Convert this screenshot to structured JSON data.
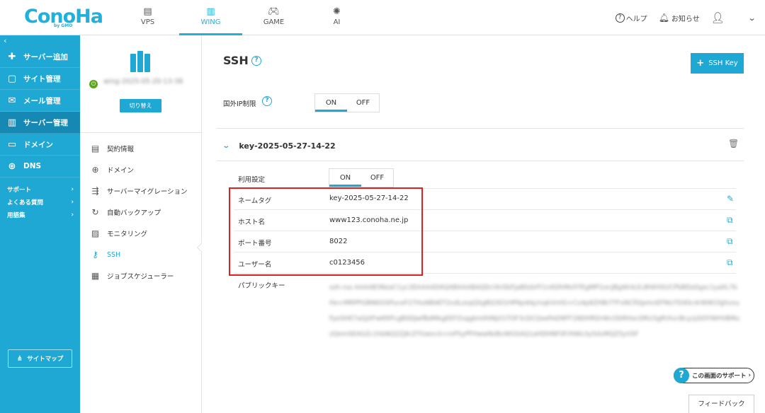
{
  "brand": {
    "logo": "ConoHa",
    "logo_sub": "by GMO",
    "accent": "#1fa8d4"
  },
  "topnav": [
    {
      "label": "VPS",
      "icon": "server-stack-icon"
    },
    {
      "label": "WING",
      "icon": "wing-server-icon",
      "active": true
    },
    {
      "label": "GAME",
      "icon": "gamepad-icon"
    },
    {
      "label": "AI",
      "icon": "ai-chip-icon"
    }
  ],
  "topright": {
    "help": "ヘルプ",
    "notice": "お知らせ"
  },
  "sidebar": {
    "items": [
      {
        "label": "サーバー追加",
        "icon": "plus-icon"
      },
      {
        "label": "サイト管理",
        "icon": "window-icon"
      },
      {
        "label": "メール管理",
        "icon": "mail-icon"
      },
      {
        "label": "サーバー管理",
        "icon": "server-icon",
        "active": true
      },
      {
        "label": "ドメイン",
        "icon": "domain-icon"
      },
      {
        "label": "DNS",
        "icon": "globe-icon"
      }
    ],
    "links": [
      "サポート",
      "よくある質問",
      "用語集"
    ],
    "sitemap": "サイトマップ"
  },
  "server": {
    "name": "wing-2025-05-20-13-38",
    "switch_label": "切り替え"
  },
  "subnav": [
    {
      "label": "契約情報",
      "icon": "contract-icon"
    },
    {
      "label": "ドメイン",
      "icon": "globe-icon"
    },
    {
      "label": "サーバーマイグレーション",
      "icon": "migration-icon"
    },
    {
      "label": "自動バックアップ",
      "icon": "backup-icon"
    },
    {
      "label": "モニタリング",
      "icon": "chart-icon"
    },
    {
      "label": "SSH",
      "icon": "key-icon",
      "active": true
    },
    {
      "label": "ジョブスケジューラー",
      "icon": "scheduler-icon"
    }
  ],
  "main": {
    "title": "SSH",
    "add_key_label": "SSH Key",
    "ip_restrict_label": "国外IP制限",
    "toggle_on": "ON",
    "toggle_off": "OFF",
    "key_name": "key-2025-05-27-14-22",
    "use_setting_label": "利用設定",
    "rows": [
      {
        "key": "ネームタグ",
        "value": "key-2025-05-27-14-22",
        "action": "pencil-icon"
      },
      {
        "key": "ホスト名",
        "value": "www123.conoha.ne.jp",
        "action": "copy-icon"
      },
      {
        "key": "ポート番号",
        "value": "8022",
        "action": "copy-icon"
      },
      {
        "key": "ユーザー名",
        "value": "c0123456",
        "action": "copy-icon"
      }
    ],
    "pubkey_label": "パブリックキー",
    "pubkey_value": "ssh-rsa AAAAB3NzaC1yc2EAAAADAQABAAABAQDcVkiSbFJaBSdxfY1nKDhMo5TEgMPi1ecJBgWnk2L8hKHSUCPbBDaSgsc1ya0L7bHe+MRPPGBNK0iSPuceF27HuNB4ET2vdLzsqQSgBQ3D1HP6p4Ay/nqkVmlG+Cx4p8ZHBi7TFxNCfiQpmnEFNU7D4Sc4rWW1fghvxuFyeSHE7aQjXFwKRPcgB0DJwfBdMkgEEFZsqgkmlHINjV1TOF3cDCQxePeD9FF1NDHRDrWcODRHxcDRU3gRtXvcBcy/yDOYWHVBMuzQemSEAGZc1hbNQ2ZjKrZTGwxvS+mPSyPFHwwNzBvWGSAQ1aHDHNF0F/HWs3y5dvMQZ5yVSF"
  },
  "support_bubble": "この画面のサポート",
  "feedback": "フィードバック"
}
